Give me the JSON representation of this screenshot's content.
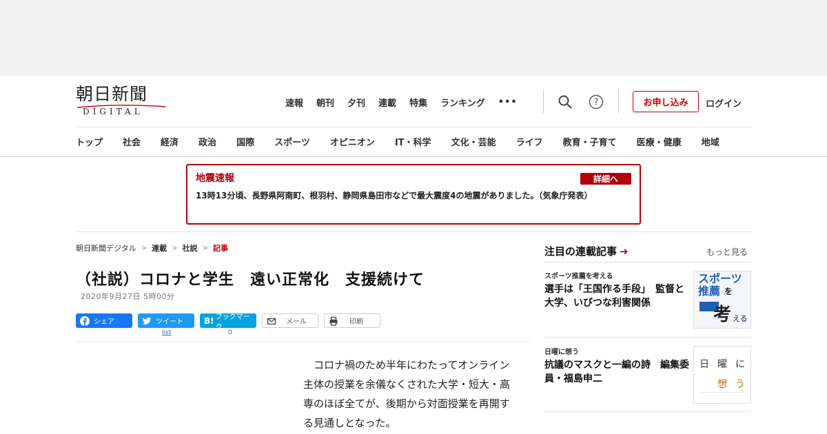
{
  "logo": {
    "main": "朝日新聞",
    "sub": "DIGITAL"
  },
  "topnav": [
    "速報",
    "朝刊",
    "夕刊",
    "連載",
    "特集",
    "ランキング"
  ],
  "more_dots": "•••",
  "apply_label": "お申し込み",
  "login_label": "ログイン",
  "categories": [
    "トップ",
    "社会",
    "経済",
    "政治",
    "国際",
    "スポーツ",
    "オピニオン",
    "IT・科学",
    "文化・芸能",
    "ライフ",
    "教育・子育て",
    "医療・健康",
    "地域"
  ],
  "alert": {
    "title": "地震速報",
    "button": "詳細へ",
    "body": "13時13分頃、長野県阿南町、根羽村、静岡県島田市などで最大震度4の地震がありました。（気象庁発表）"
  },
  "breadcrumb": [
    "朝日新聞デジタル",
    "連載",
    "社説",
    "記事"
  ],
  "article": {
    "title": "（社説）コロナと学生　遠い正常化　支援続けて",
    "date": "2020年9月27日 5時00分",
    "lead": "コロナ禍のため半年にわたってオンライン主体の授業を余儀なくされた大学・短大・高専のほぼ全てが、後期から対面授業を再開する見通しとなった。"
  },
  "share": {
    "facebook": "シェア",
    "twitter": "ツイート",
    "hatena": "ブックマーク",
    "mail": "メール",
    "print": "印刷",
    "twitter_count": "list",
    "hatena_count": "0"
  },
  "sidebar": {
    "title": "注目の連載記事",
    "more": "もっと見る",
    "items": [
      {
        "category": "スポーツ推薦を考える",
        "headline": "選手は「王国作る手段」　監督と大学、いびつな利害関係",
        "thumb_text_1": "スポーツ",
        "thumb_text_2": "推薦",
        "thumb_text_3": "を",
        "thumb_text_4": "考",
        "thumb_text_5": "える"
      },
      {
        "category": "日曜に想う",
        "headline": "抗議のマスクと一編の詩　編集委員・福島申二",
        "thumb_text_1": "日",
        "thumb_text_2": "曜",
        "thumb_text_3": "に",
        "thumb_text_4": "想",
        "thumb_text_5": "う"
      }
    ]
  },
  "colors": {
    "accent_red": "#c4000a",
    "alert_red": "#b0000b",
    "facebook": "#1877f2",
    "twitter": "#1d9bf0",
    "hatena": "#00a4de"
  }
}
